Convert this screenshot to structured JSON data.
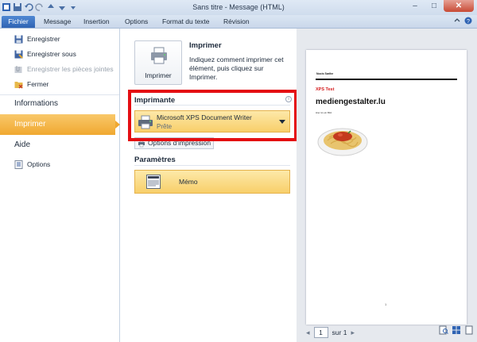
{
  "window": {
    "title": "Sans titre  -  Message (HTML)",
    "controls": [
      "–",
      "□",
      "✕"
    ]
  },
  "ribbon": {
    "tabs": [
      "Fichier",
      "Message",
      "Insertion",
      "Options",
      "Format du texte",
      "Révision"
    ]
  },
  "nav": {
    "commands": [
      {
        "label": "Enregistrer",
        "icon": "save-icon",
        "enabled": true
      },
      {
        "label": "Enregistrer sous",
        "icon": "save-as-icon",
        "enabled": true
      },
      {
        "label": "Enregistrer les pièces jointes",
        "icon": "attachments-icon",
        "enabled": false
      },
      {
        "label": "Fermer",
        "icon": "folder-close-icon",
        "enabled": true
      }
    ],
    "tabs": [
      "Informations",
      "Imprimer",
      "Aide"
    ],
    "options_label": "Options",
    "active_tab": "Imprimer"
  },
  "print": {
    "section_title": "Imprimer",
    "button_label": "Imprimer",
    "description": "Indiquez comment imprimer cet élément, puis cliquez sur Imprimer."
  },
  "printer": {
    "section_title": "Imprimante",
    "info_glyph": "i",
    "name": "Microsoft XPS Document Writer",
    "status": "Prête",
    "properties_label": "Options d'impression"
  },
  "settings": {
    "section_title": "Paramètres",
    "style_label": "Mémo"
  },
  "preview": {
    "from_name": "Nocis Sarihe",
    "subject": "XPS Test",
    "site": "mediengestalter.lu",
    "small_text": "Hier ist ein Bild.",
    "page_number": "1",
    "pager": {
      "current": "1",
      "total_text": "sur 1",
      "prev": "◂",
      "next": "▸"
    }
  },
  "colors": {
    "accent_orange": "#f0a830",
    "highlight_red": "#e40d12",
    "file_tab_blue": "#2f63b3"
  }
}
